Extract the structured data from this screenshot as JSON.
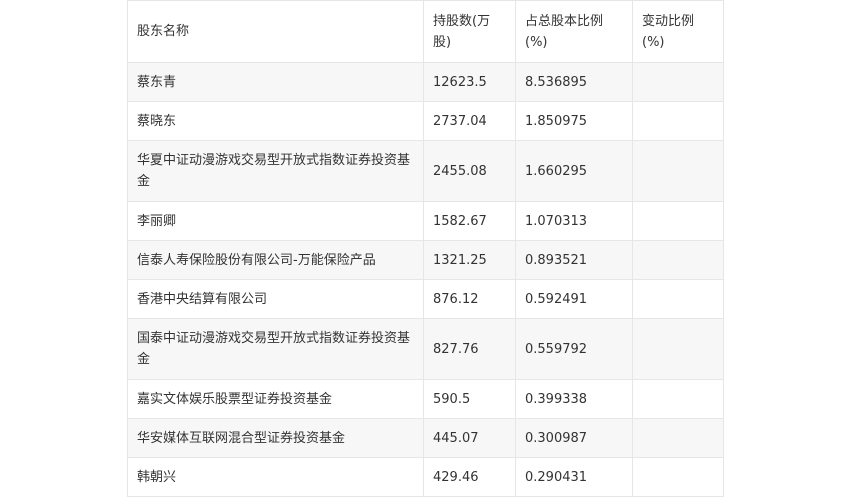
{
  "headers": {
    "name": "股东名称",
    "shares": "持股数(万股)",
    "ratio": "占总股本比例(%)",
    "change": "变动比例(%)"
  },
  "rows": [
    {
      "name": "蔡东青",
      "shares": "12623.5",
      "ratio": "8.536895",
      "change": ""
    },
    {
      "name": "蔡晓东",
      "shares": "2737.04",
      "ratio": "1.850975",
      "change": ""
    },
    {
      "name": "华夏中证动漫游戏交易型开放式指数证券投资基金",
      "shares": "2455.08",
      "ratio": "1.660295",
      "change": ""
    },
    {
      "name": "李丽卿",
      "shares": "1582.67",
      "ratio": "1.070313",
      "change": ""
    },
    {
      "name": "信泰人寿保险股份有限公司-万能保险产品",
      "shares": "1321.25",
      "ratio": "0.893521",
      "change": ""
    },
    {
      "name": "香港中央结算有限公司",
      "shares": "876.12",
      "ratio": "0.592491",
      "change": ""
    },
    {
      "name": "国泰中证动漫游戏交易型开放式指数证券投资基金",
      "shares": "827.76",
      "ratio": "0.559792",
      "change": ""
    },
    {
      "name": "嘉实文体娱乐股票型证券投资基金",
      "shares": "590.5",
      "ratio": "0.399338",
      "change": ""
    },
    {
      "name": "华安媒体互联网混合型证券投资基金",
      "shares": "445.07",
      "ratio": "0.300987",
      "change": ""
    },
    {
      "name": "韩朝兴",
      "shares": "429.46",
      "ratio": "0.290431",
      "change": ""
    }
  ]
}
